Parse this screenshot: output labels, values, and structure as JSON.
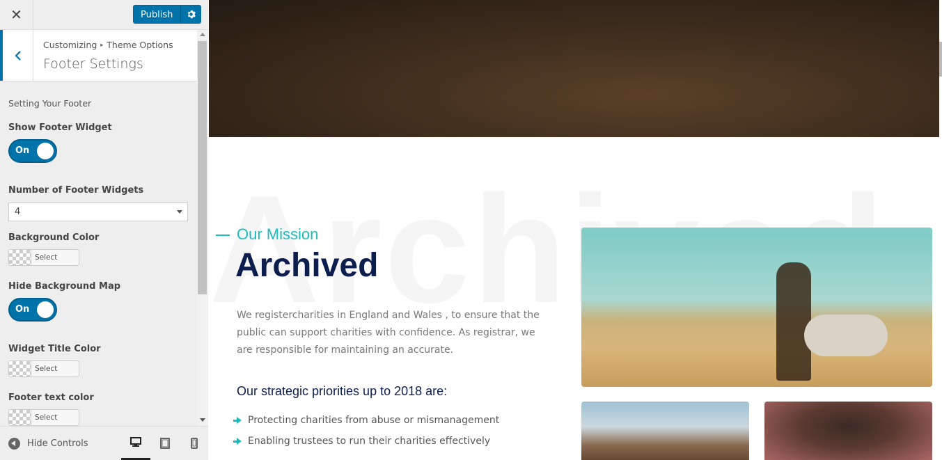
{
  "topbar": {
    "close_icon": "close-icon",
    "publish_label": "Publish",
    "gear_icon": "gear-icon",
    "accent": "#0073aa"
  },
  "section": {
    "breadcrumb_root": "Customizing",
    "breadcrumb_current": "Theme Options",
    "title": "Footer Settings"
  },
  "controls": {
    "description": "Setting Your Footer",
    "show_footer_widget": {
      "label": "Show Footer Widget",
      "state": "On"
    },
    "number_of_widgets": {
      "label": "Number of Footer Widgets",
      "value": "4"
    },
    "background_color": {
      "label": "Background Color",
      "button": "Select Color"
    },
    "hide_background_map": {
      "label": "Hide Background Map",
      "state": "On"
    },
    "widget_title_color": {
      "label": "Widget Title Color",
      "button": "Select Color"
    },
    "footer_text_color": {
      "label": "Footer text color",
      "button": "Select Color"
    }
  },
  "footer": {
    "hide_controls": "Hide Controls",
    "devices": [
      "desktop",
      "tablet",
      "mobile"
    ],
    "active_device": "desktop"
  },
  "preview": {
    "watermark": "Archived",
    "mission_label": "Our Mission",
    "heading": "Archived",
    "paragraph": "We registercharities in England and Wales , to ensure that the public can support charities with confidence. As registrar, we are responsible for maintaining an accurate.",
    "priorities_title": "Our strategic priorities up to 2018 are:",
    "priorities": [
      "Protecting charities from abuse or mismanagement",
      "Enabling trustees to run their charities effectively"
    ],
    "accent": "#1ebbbd",
    "heading_color": "#0c1e4d"
  }
}
